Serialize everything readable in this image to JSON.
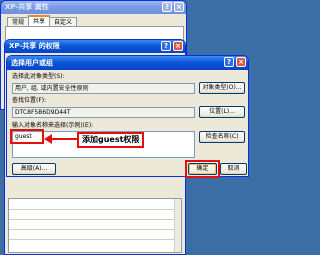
{
  "back_window": {
    "title": "XP-共享 属性",
    "tabs": [
      "常规",
      "共享",
      "自定义"
    ],
    "active_tab": 1
  },
  "perm_window": {
    "title": "XP-共享 的权限"
  },
  "dialog": {
    "title": "选择用户或组",
    "object_type_label": "选择此对象类型(S):",
    "object_type_value": "用户, 组, 或内置安全性原则",
    "object_types_button": "对象类型(O)...",
    "location_label": "查找位置(F):",
    "location_value": "DTC8F5B6D9D44T",
    "location_button": "位置(L)...",
    "names_label": "输入对象名称来选择(示例)(E):",
    "names_value": "guest",
    "check_names_button": "检查名称(C)",
    "advanced_button": "高级(A)...",
    "ok_button": "确定",
    "cancel_button": "取消"
  },
  "annotation": {
    "text": "添加guest权限",
    "color": "#e30f0f"
  },
  "colors": {
    "desktop": "#3a6ea5",
    "titlebar": "#0a55d8",
    "dialog_bg": "#ece9d8"
  }
}
